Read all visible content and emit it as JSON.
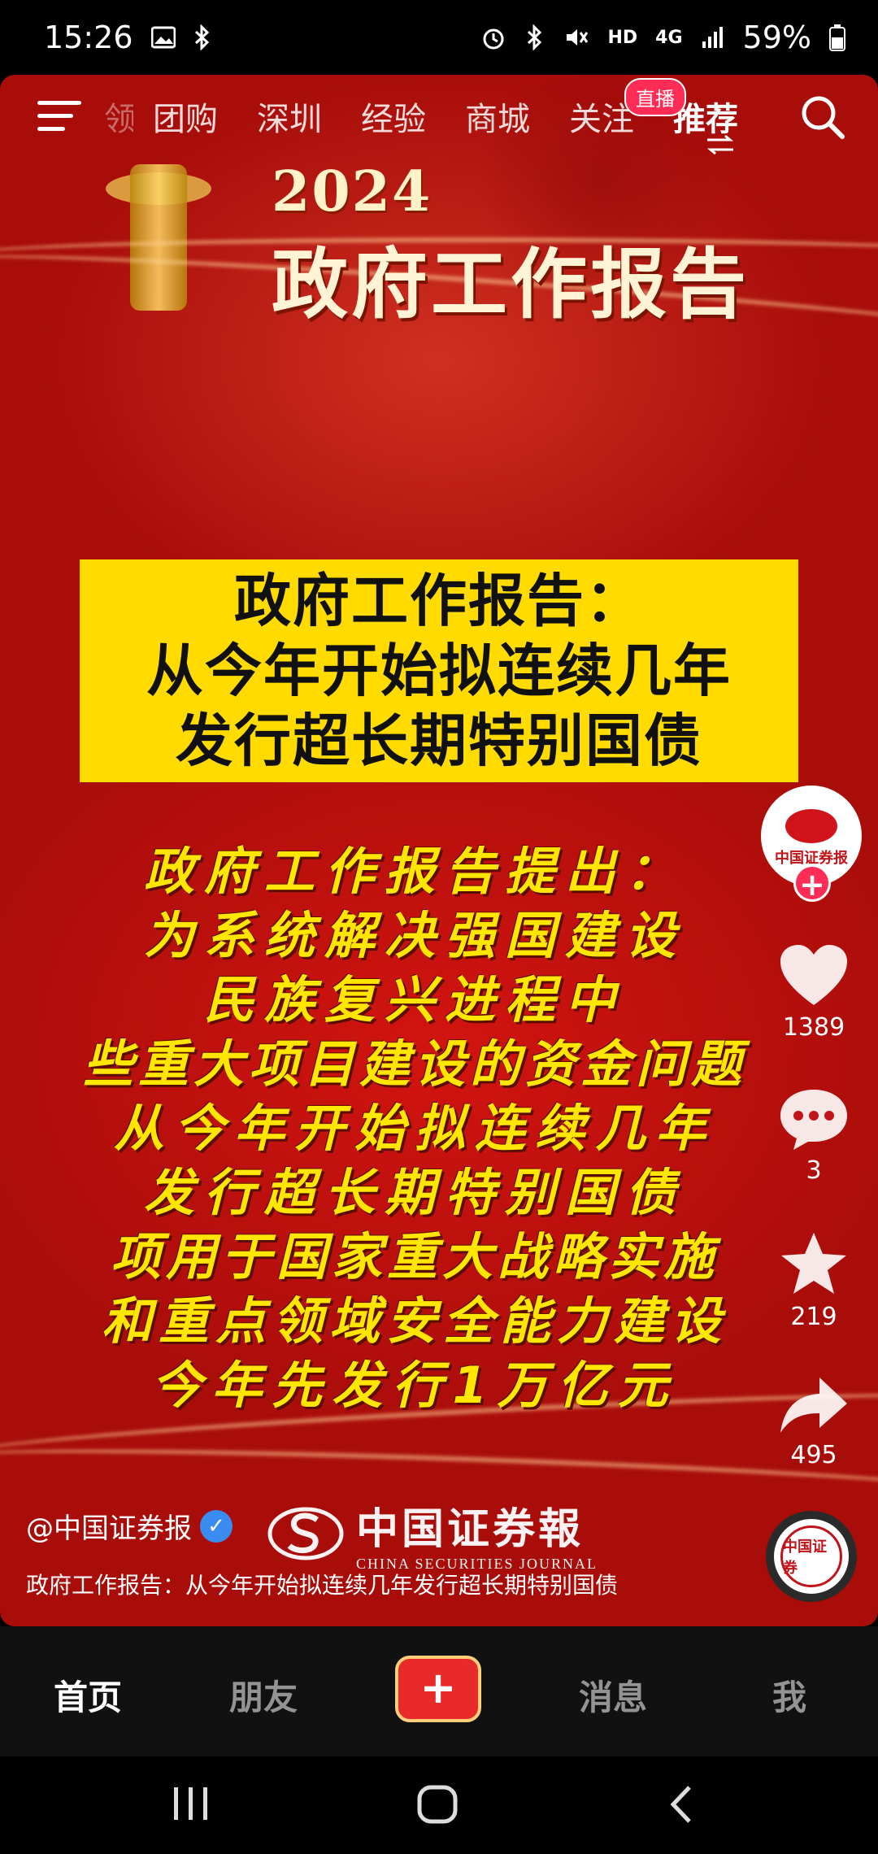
{
  "status_bar": {
    "time": "15:26",
    "network": "4G",
    "hd": "HD",
    "battery": "59%"
  },
  "top_nav": {
    "tabs": [
      "领",
      "团购",
      "深圳",
      "经验",
      "商城",
      "关注",
      "推荐"
    ],
    "active_tab": "推荐",
    "live_badge": "直播"
  },
  "video": {
    "year": "2024",
    "main_title": "政府工作报告",
    "headline_lines": [
      "政府工作报告：",
      "从今年开始拟连续几年",
      "发行超长期特别国债"
    ],
    "body_lines": [
      "政府工作报告提出：",
      "为系统解决强国建设",
      "民族复兴进程中",
      "些重大项目建设的资金问题",
      "从今年开始拟连续几年",
      "发行超长期特别国债",
      "项用于国家重大战略实施",
      "和重点领域安全能力建设",
      "今年先发行1万亿元"
    ]
  },
  "side_actions": {
    "avatar_text": "中国证券报",
    "likes": "1389",
    "comments": "3",
    "favorites": "219",
    "shares": "495",
    "disc_text": "中国证券"
  },
  "post": {
    "author": "@中国证券报",
    "brand_cn": "中国证券報",
    "brand_en": "CHINA SECURITIES JOURNAL",
    "caption": "政府工作报告：从今年开始拟连续几年发行超长期特别国债"
  },
  "bottom_nav": {
    "home": "首页",
    "friends": "朋友",
    "create": "+",
    "messages": "消息",
    "me": "我"
  }
}
